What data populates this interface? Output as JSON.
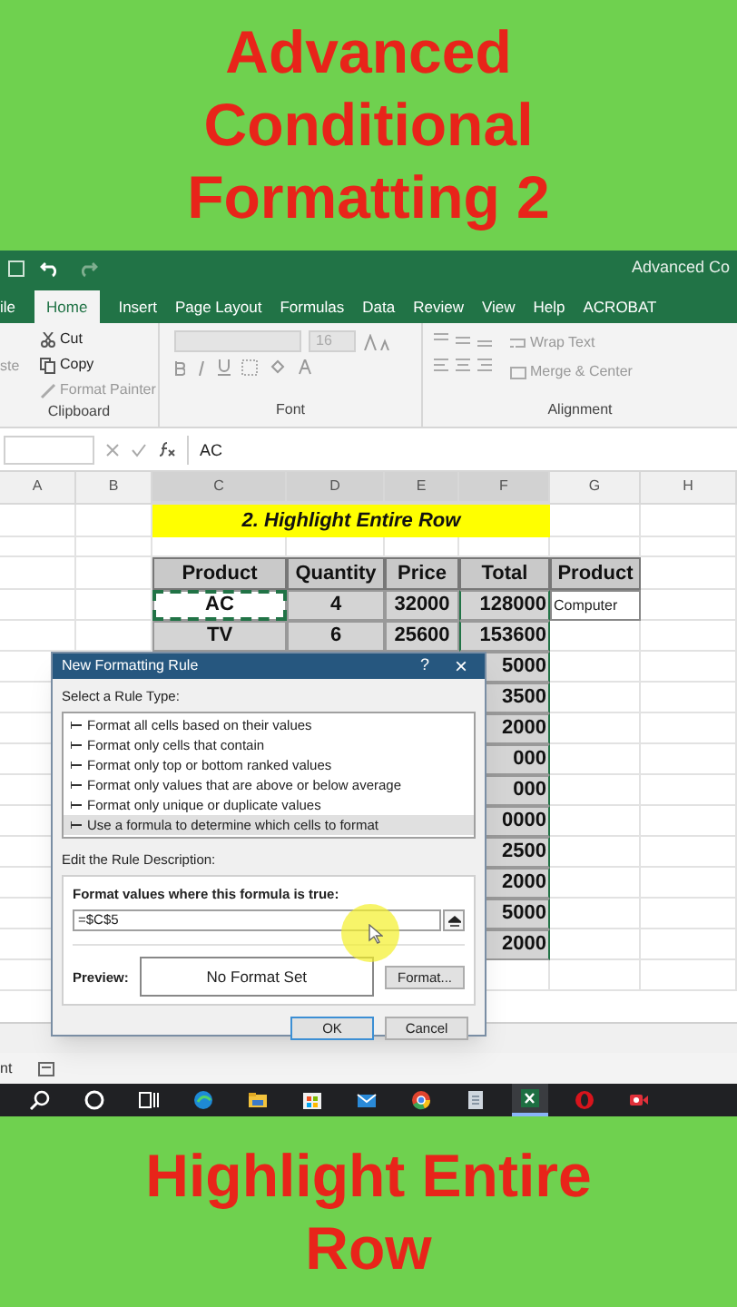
{
  "headline": "Advanced Conditional Formatting 2",
  "window": {
    "title": "Advanced Co"
  },
  "ribbon_tabs": [
    {
      "label": "ile",
      "selected": false
    },
    {
      "label": "Home",
      "selected": true
    },
    {
      "label": "Insert",
      "selected": false
    },
    {
      "label": "Page Layout",
      "selected": false
    },
    {
      "label": "Formulas",
      "selected": false
    },
    {
      "label": "Data",
      "selected": false
    },
    {
      "label": "Review",
      "selected": false
    },
    {
      "label": "View",
      "selected": false
    },
    {
      "label": "Help",
      "selected": false
    },
    {
      "label": "ACROBAT",
      "selected": false
    }
  ],
  "clipboard": {
    "paste": "ste",
    "cut": "Cut",
    "copy": "Copy",
    "format_painter": "Format Painter",
    "label": "Clipboard"
  },
  "font": {
    "size": "16",
    "label": "Font"
  },
  "alignment": {
    "wrap_text": "Wrap Text",
    "merge": "Merge & Center",
    "label": "Alignment"
  },
  "formula_bar": {
    "value": "AC"
  },
  "columns": [
    {
      "label": "A",
      "selected": false
    },
    {
      "label": "B",
      "selected": false
    },
    {
      "label": "C",
      "selected": true
    },
    {
      "label": "D",
      "selected": true
    },
    {
      "label": "E",
      "selected": true
    },
    {
      "label": "F",
      "selected": true
    },
    {
      "label": "G",
      "selected": false
    },
    {
      "label": "H",
      "selected": false
    }
  ],
  "banner": "2. Highlight Entire Row",
  "table": {
    "header": [
      "Product",
      "Quantity",
      "Price",
      "Total",
      "Product"
    ],
    "rows": [
      {
        "product": "AC",
        "quantity": "4",
        "price": "32000",
        "total": "128000",
        "note": "Computer",
        "marquee": true
      },
      {
        "product": "TV",
        "quantity": "6",
        "price": "25600",
        "total": "153600",
        "marquee": false
      },
      {
        "total": "5000"
      },
      {
        "total": "3500"
      },
      {
        "total": "2000"
      },
      {
        "total": "000"
      },
      {
        "total": "000"
      },
      {
        "total": "0000"
      },
      {
        "total": "2500"
      },
      {
        "total": "2000"
      },
      {
        "total": "5000"
      },
      {
        "total": "2000"
      }
    ]
  },
  "dialog": {
    "title": "New Formatting Rule",
    "help": "?",
    "close": "×",
    "select_label": "Select a Rule Type:",
    "rule_types": [
      {
        "label": "Format all cells based on their values",
        "selected": false
      },
      {
        "label": "Format only cells that contain",
        "selected": false
      },
      {
        "label": "Format only top or bottom ranked values",
        "selected": false
      },
      {
        "label": "Format only values that are above or below average",
        "selected": false
      },
      {
        "label": "Format only unique or duplicate values",
        "selected": false
      },
      {
        "label": "Use a formula to determine which cells to format",
        "selected": true
      }
    ],
    "edit_label": "Edit the Rule Description:",
    "formula_label": "Format values where this formula is true:",
    "formula": "=$C$5",
    "preview_label": "Preview:",
    "preview": "No Format Set",
    "format_button": "Format...",
    "ok": "OK",
    "cancel": "Cancel"
  },
  "status_bar": {
    "text": "nt"
  },
  "taskbar": {
    "apps": [
      {
        "kind": "search",
        "selected": false
      },
      {
        "kind": "cortana",
        "selected": false
      },
      {
        "kind": "taskview",
        "selected": false
      },
      {
        "kind": "edge",
        "selected": false
      },
      {
        "kind": "folder",
        "selected": false
      },
      {
        "kind": "store",
        "selected": false
      },
      {
        "kind": "mail",
        "selected": false
      },
      {
        "kind": "chrome",
        "selected": false
      },
      {
        "kind": "notes",
        "selected": false
      },
      {
        "kind": "excel",
        "selected": true
      },
      {
        "kind": "opera",
        "selected": false
      },
      {
        "kind": "recorder",
        "selected": false
      }
    ]
  },
  "footer_headline": "Highlight Entire Row"
}
